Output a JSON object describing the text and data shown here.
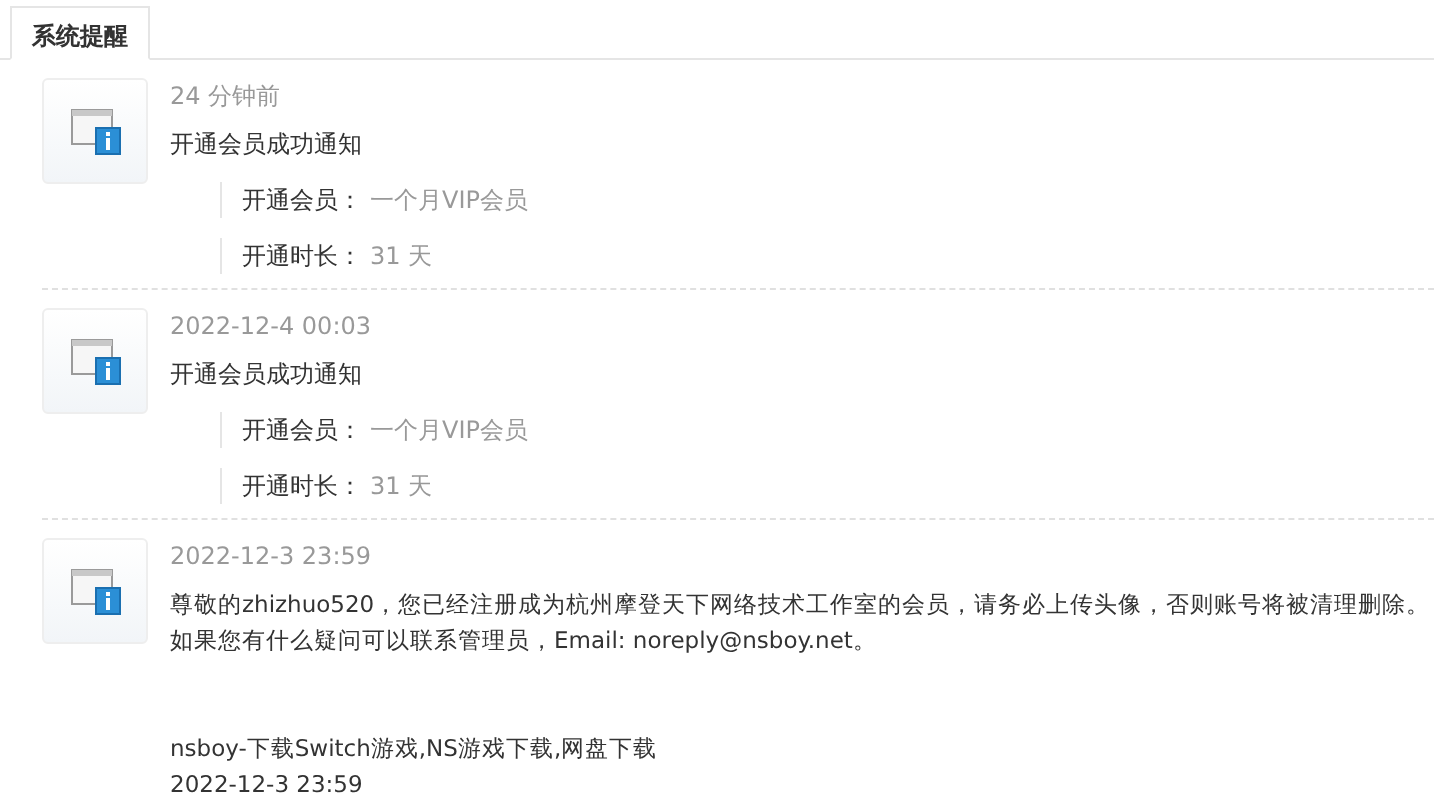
{
  "tabs": [
    {
      "label": "系统提醒",
      "selected": true
    }
  ],
  "notifications": [
    {
      "kind": "membership",
      "time": "24 分钟前",
      "title": "开通会员成功通知",
      "fields": [
        {
          "label": "开通会员：",
          "value": "一个月VIP会员"
        },
        {
          "label": "开通时长：",
          "value": "31 天"
        }
      ]
    },
    {
      "kind": "membership",
      "time": "2022-12-4 00:03",
      "title": "开通会员成功通知",
      "fields": [
        {
          "label": "开通会员：",
          "value": "一个月VIP会员"
        },
        {
          "label": "开通时长：",
          "value": "31 天"
        }
      ]
    },
    {
      "kind": "message",
      "time": "2022-12-3 23:59",
      "lines": [
        "尊敬的zhizhuo520，您已经注册成为杭州摩登天下网络技术工作室的会员，请务必上传头像，否则账号将被清理删除。",
        "如果您有什么疑问可以联系管理员，Email: noreply@nsboy.net。"
      ],
      "signature": [
        "nsboy-下载Switch游戏,NS游戏下载,网盘下载",
        "2022-12-3 23:59"
      ]
    }
  ]
}
